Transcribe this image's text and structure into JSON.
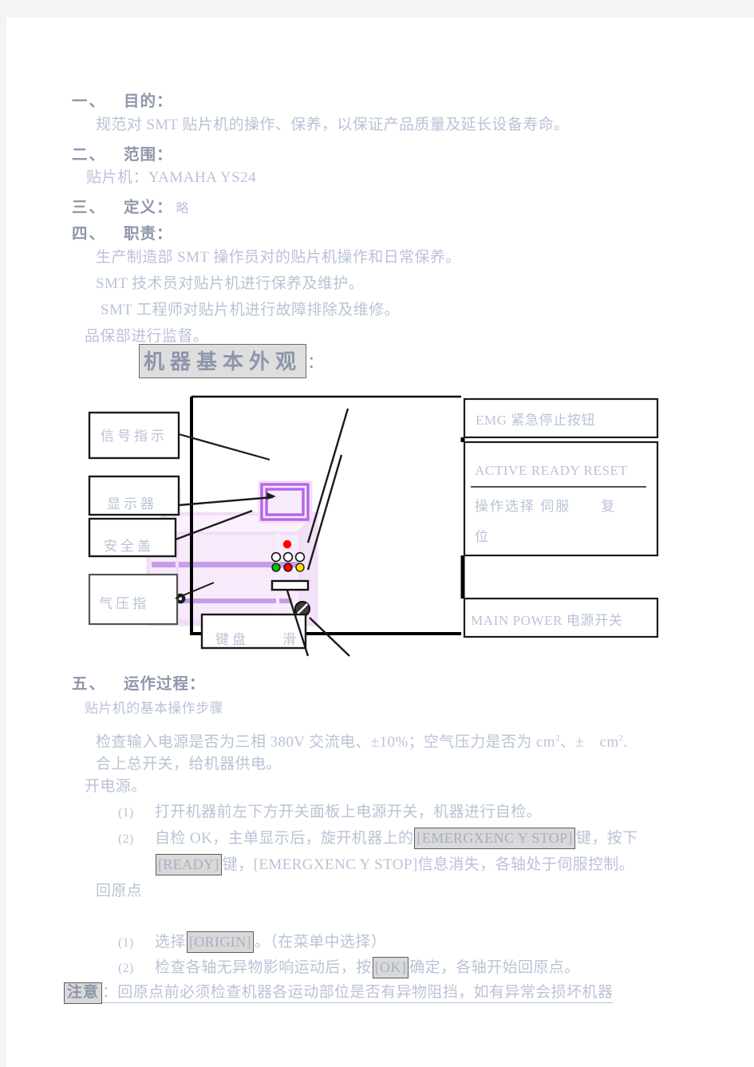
{
  "document": {
    "sections": [
      {
        "num": "一、",
        "title": "目的："
      },
      {
        "num": "二、",
        "title": "范围："
      },
      {
        "num": "三、",
        "title": "定义：",
        "inline": "略"
      },
      {
        "num": "四、",
        "title": "职责："
      },
      {
        "num": "五、",
        "title": "运作过程："
      }
    ],
    "purpose_text": "规范对 SMT 贴片机的操作、保养，以保证产品质量及延长设备寿命。",
    "scope_text": "贴片机：YAMAHA YS24",
    "duties": [
      "生产制造部 SMT 操作员对的贴片机操作和日常保养。",
      "SMT 技术员对贴片机进行保养及维护。",
      "SMT 工程师对贴片机进行故障排除及维修。",
      "品保部进行监督。"
    ],
    "appearance_heading": "机器基本外观",
    "appearance_heading_colon": "：",
    "operation": {
      "intro": "贴片机的基本操作步骤",
      "check_power_a": "检查输入电源是否为三相 380V 交流电、±10%；空气压力是否为 cm",
      "check_power_sup1": "2",
      "check_power_b": "、±　cm",
      "check_power_sup2": "2",
      "check_power_c": ".",
      "check_power_line2": "合上总开关，给机器供电。",
      "power_on": "开电源。",
      "step1_num": "(1)",
      "step1_text": "打开机器前左下方开关面板上电源开关，机器进行自检。",
      "step2_num": "(2)",
      "step2_a": "自检 OK，主单显示后，旋开机器上的",
      "step2_key1": "[EMERGXENC Y  STOP]",
      "step2_b": "键，按下",
      "step2_key2": "[READY]",
      "step2_c": "键，[EMERGXENC Y  STOP]信息消失，各轴处于伺服控制。",
      "origin_heading": "回原点",
      "step3_num": "(1)",
      "step3_a": "选择",
      "step3_key": "[ORIGIN]",
      "step3_b": "。（在菜单中选择）",
      "step4_num": "(2)",
      "step4_a": "检查各轴无异物影响运动后，按",
      "step4_key": "[OK]",
      "step4_b": "确定，各轴开始回原点。",
      "note_badge": "注意",
      "note_colon": "：",
      "note_text": "回原点前必须检查机器各运动部位是否有异物阻挡，如有异常会损坏机器"
    }
  },
  "diagram": {
    "left_labels": [
      "信号指示",
      "显示器",
      "安全盖",
      "气压指"
    ],
    "bottom_label": "键盘　　滑",
    "right_labels": [
      {
        "text": "EMG 紧急停止按钮"
      },
      {
        "text": "ACTIVE READY RESET"
      },
      {
        "text": "操作选择 伺服　　复"
      },
      {
        "text": "位"
      },
      {
        "text": "MAIN POWER 电源开关"
      }
    ],
    "colors": {
      "machine_body": "#f3e2f7",
      "machine_accent": "#c89ce8",
      "monitor_frame": "#b565e8",
      "lamp_red": "#ff0000",
      "lamp_green": "#00c000",
      "lamp_yellow": "#ffe000",
      "outline": "#000000"
    }
  }
}
